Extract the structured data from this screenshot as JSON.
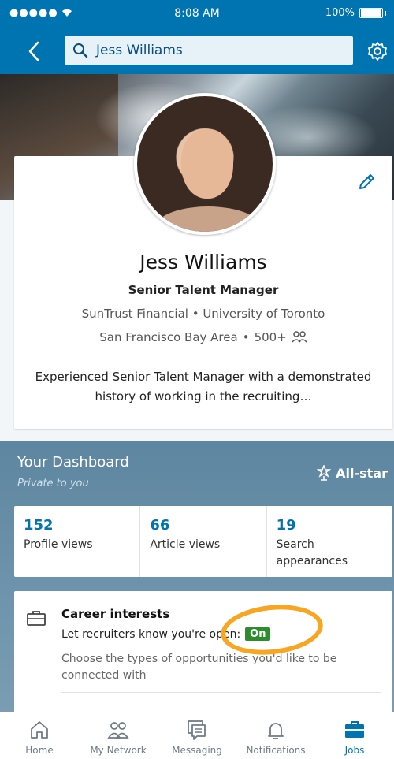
{
  "status_bar": {
    "signal": "●●●●●",
    "time": "8:08 AM",
    "battery": "100%"
  },
  "nav": {
    "search_value": "Jess Williams"
  },
  "profile": {
    "name": "Jess Williams",
    "headline": "Senior Talent Manager",
    "org": "SunTrust Financial • University of Toronto",
    "location": "San Francisco Bay Area",
    "connections": "500+",
    "summary": "Experienced Senior Talent Manager with a demonstrated history of working in the recruiting…"
  },
  "dashboard": {
    "title": "Your Dashboard",
    "subtitle": "Private to you",
    "allstar": "All-star",
    "stats": [
      {
        "value": "152",
        "label": "Profile views"
      },
      {
        "value": "66",
        "label": "Article views"
      },
      {
        "value": "19",
        "label": "Search appearances"
      }
    ],
    "career": {
      "title": "Career interests",
      "line": "Let recruiters know you're open:",
      "status": "On",
      "description": "Choose the types of opportunities you'd like to be connected with"
    }
  },
  "tabs": [
    {
      "label": "Home"
    },
    {
      "label": "My Network"
    },
    {
      "label": "Messaging"
    },
    {
      "label": "Notifications"
    },
    {
      "label": "Jobs"
    }
  ],
  "colors": {
    "brand": "#0073b1",
    "highlight": "#f6a623",
    "on_badge": "#2e8b2e"
  }
}
